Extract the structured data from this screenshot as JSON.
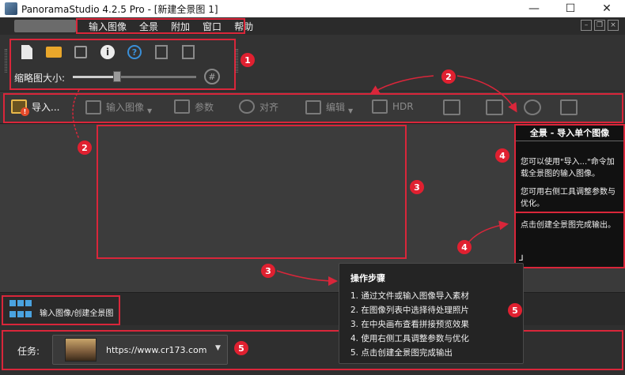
{
  "window": {
    "title": "PanoramaStudio 4.2.5 Pro - [新建全景图 1]",
    "minimize": "—",
    "maximize": "☐",
    "close": "✕"
  },
  "menu": {
    "items": [
      "输入图像",
      "全景",
      "附加",
      "窗口",
      "帮助"
    ]
  },
  "mdi": {
    "min": "–",
    "restore": "❐",
    "close": "×"
  },
  "tools": {
    "info_glyph": "i",
    "help_glyph": "?",
    "thumbnail_label": "缩略图大小:",
    "thumbnail_size": 0.36,
    "hash_glyph": "#"
  },
  "toolbar": {
    "import": "导入...",
    "import_badge": "!",
    "input_images": "输入图像",
    "params": "参数",
    "align": "对齐",
    "edit": "编辑",
    "hdr": "HDR"
  },
  "help_panel": {
    "title": "全景 - 导入单个图像",
    "para1": "您可以使用\"导入...\"命令加载全景图的输入图像。",
    "para2": "您可用右侧工具调整参数与优化。",
    "para3": "点击创建全景图完成输出。",
    "corner_glyph": "⅃"
  },
  "steps": {
    "title": "操作步骤",
    "items": [
      "1. 通过文件或输入图像导入素材",
      "2. 在图像列表中选择待处理照片",
      "3. 在中央画布查看拼接预览效果",
      "4. 使用右侧工具调整参数与优化",
      "5. 点击创建全景图完成输出"
    ]
  },
  "bottom": {
    "label": "输入图像/创建全景图"
  },
  "task": {
    "label": "任务:",
    "value": "https://www.cr173.com",
    "arrow": "▼"
  },
  "callouts": {
    "c1": "1",
    "c2a": "2",
    "c2b": "2",
    "c3a": "3",
    "c3b": "3",
    "c4a": "4",
    "c4b": "4",
    "c5a": "5",
    "c5b": "5"
  },
  "colors": {
    "annotation_red": "#d9263a",
    "accent_blue": "#4aa3e0",
    "folder_orange": "#e9a72b"
  }
}
